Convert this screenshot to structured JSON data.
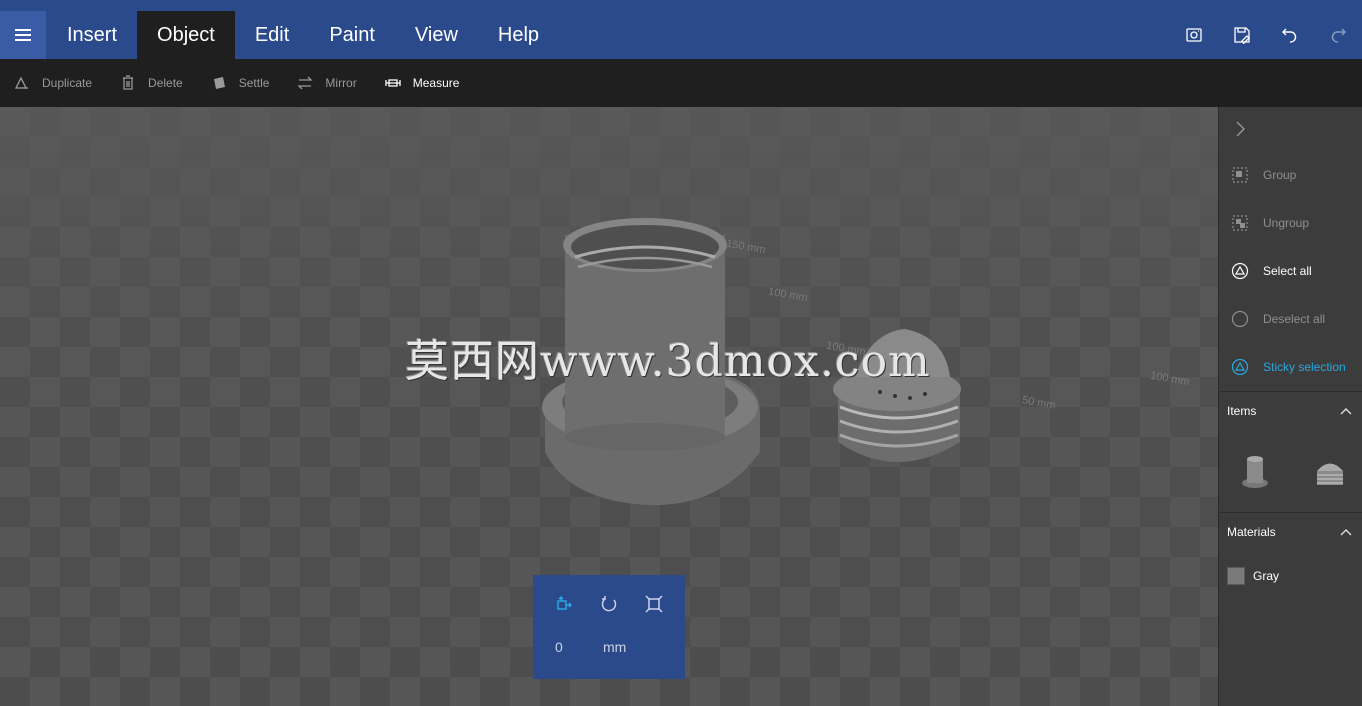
{
  "menubar": {
    "tabs": [
      {
        "label": "Insert",
        "active": false
      },
      {
        "label": "Object",
        "active": true
      },
      {
        "label": "Edit",
        "active": false
      },
      {
        "label": "Paint",
        "active": false
      },
      {
        "label": "View",
        "active": false
      },
      {
        "label": "Help",
        "active": false
      }
    ],
    "right_icons": [
      "view-3d-icon",
      "save-icon",
      "undo-icon",
      "redo-icon"
    ]
  },
  "toolbar": {
    "duplicate": "Duplicate",
    "delete": "Delete",
    "settle": "Settle",
    "mirror": "Mirror",
    "measure": "Measure"
  },
  "viewport": {
    "grid_labels": [
      "150 mm",
      "100 mm",
      "50 mm",
      "100 mm",
      "100 mm"
    ],
    "watermark": "莫西网www.3dmox.com"
  },
  "gizmo": {
    "value": "0",
    "unit": "mm",
    "active_mode": "move"
  },
  "right_panel": {
    "group": "Group",
    "ungroup": "Ungroup",
    "select_all": "Select all",
    "deselect_all": "Deselect all",
    "sticky_selection": "Sticky selection",
    "items_title": "Items",
    "materials_title": "Materials",
    "material_name": "Gray",
    "material_color": "#7a7a7a"
  },
  "colors": {
    "menubar": "#2b4a8c",
    "toolbar": "#1f1f1f",
    "accent": "#29a8e0"
  }
}
